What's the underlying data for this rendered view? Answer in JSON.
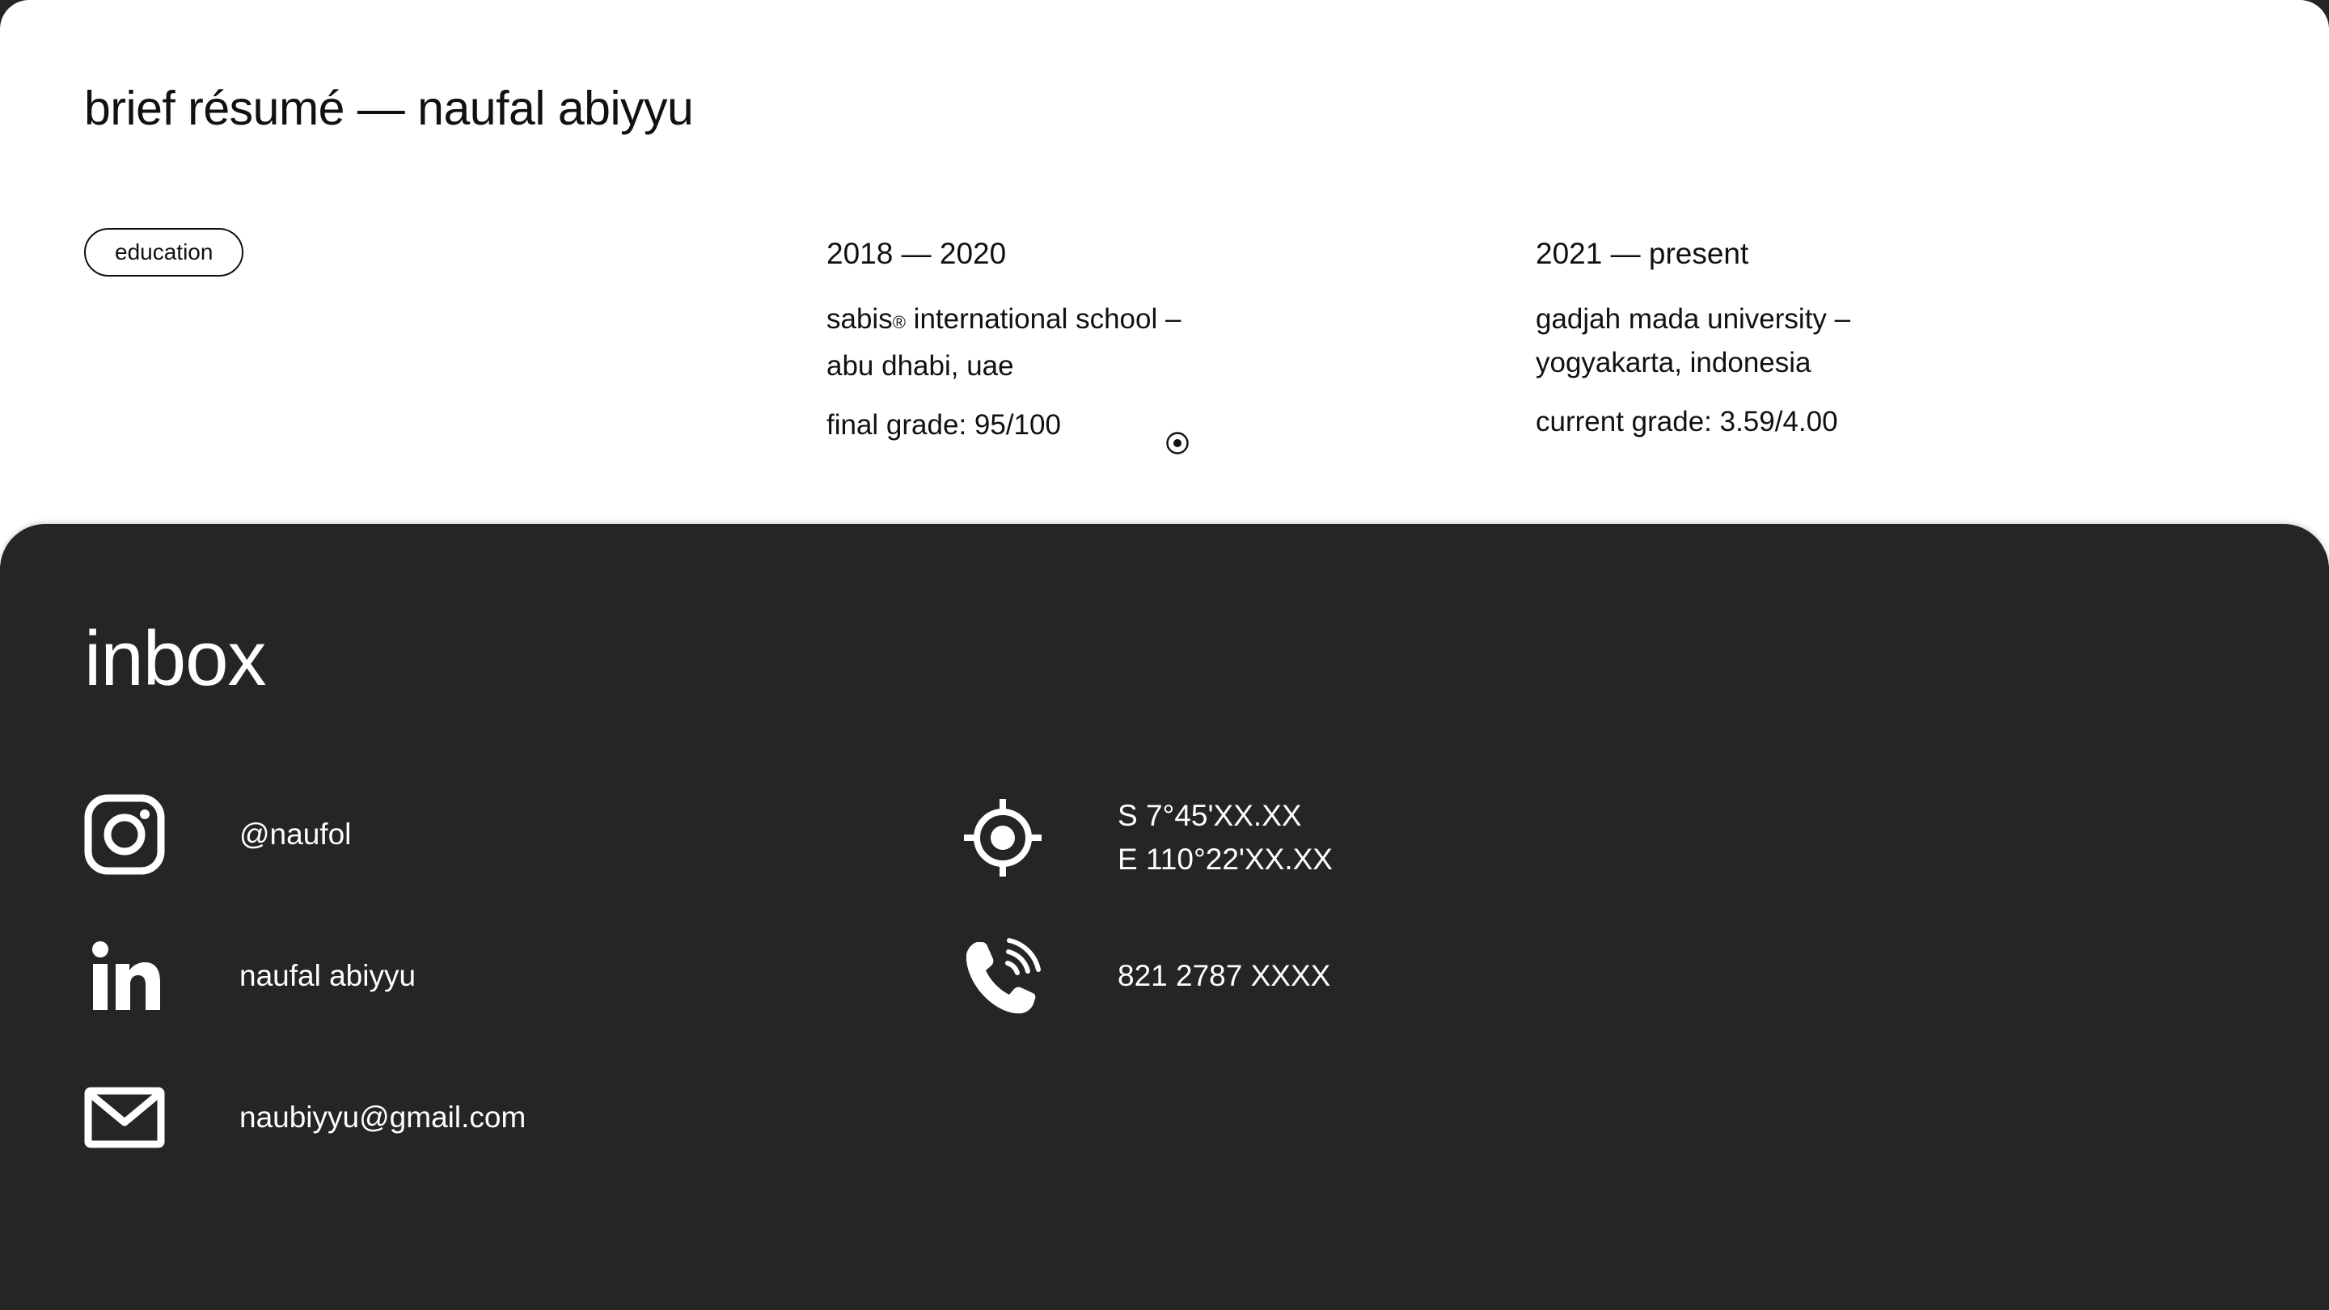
{
  "resume": {
    "title": "brief résumé — naufal abiyyu",
    "section_label": "education",
    "entries": [
      {
        "period": "2018 — 2020",
        "school_line1_name": "sabis",
        "school_line1_mark": "®",
        "school_line1_rest": " international school –",
        "school_line2": "abu dhabi, uae",
        "grade": "final grade: 95/100"
      },
      {
        "period": "2021 — present",
        "school_line1": "gadjah mada university –",
        "school_line2": "yogyakarta, indonesia",
        "grade": "current grade: 3.59/4.00"
      }
    ]
  },
  "inbox": {
    "title": "inbox",
    "instagram": {
      "icon": "instagram-icon",
      "handle": "@naufol"
    },
    "linkedin": {
      "icon": "linkedin-icon",
      "name": "naufal abiyyu"
    },
    "email": {
      "icon": "mail-icon",
      "address": "naubiyyu@gmail.com"
    },
    "location": {
      "icon": "location-crosshair-icon",
      "lat": "S 7°45'XX.XX",
      "lon": "E 110°22'XX.XX"
    },
    "phone": {
      "icon": "phone-icon",
      "number": "821 2787 XXXX"
    }
  },
  "colors": {
    "background_light": "#ffffff",
    "background_dark": "#252525",
    "text_dark": "#111111",
    "text_light": "#ffffff"
  }
}
